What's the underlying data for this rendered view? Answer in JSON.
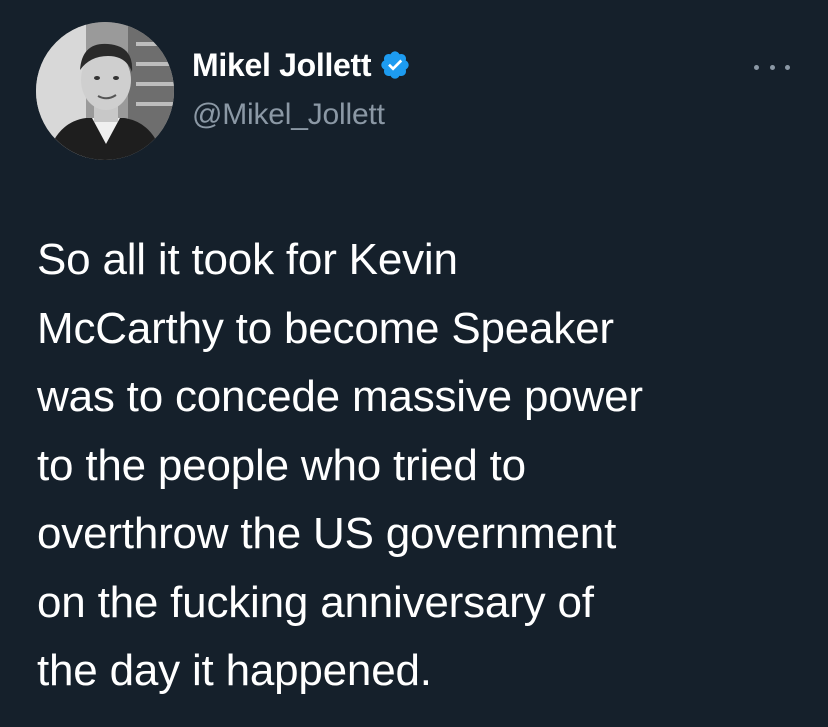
{
  "author": {
    "display_name": "Mikel Jollett",
    "handle": "@Mikel_Jollett",
    "verified_icon": "verified-badge-icon",
    "avatar_icon": "avatar"
  },
  "menu": {
    "icon": "more-options-icon"
  },
  "tweet": {
    "lines": [
      "So all it took for Kevin",
      "McCarthy to become Speaker",
      "was to concede massive power",
      "to the people who tried to",
      "overthrow the US government",
      "on the fucking anniversary of",
      "the day it happened."
    ]
  },
  "colors": {
    "background": "#15202b",
    "text": "#ffffff",
    "secondary_text": "#8b98a5",
    "verified": "#1d9bf0"
  }
}
